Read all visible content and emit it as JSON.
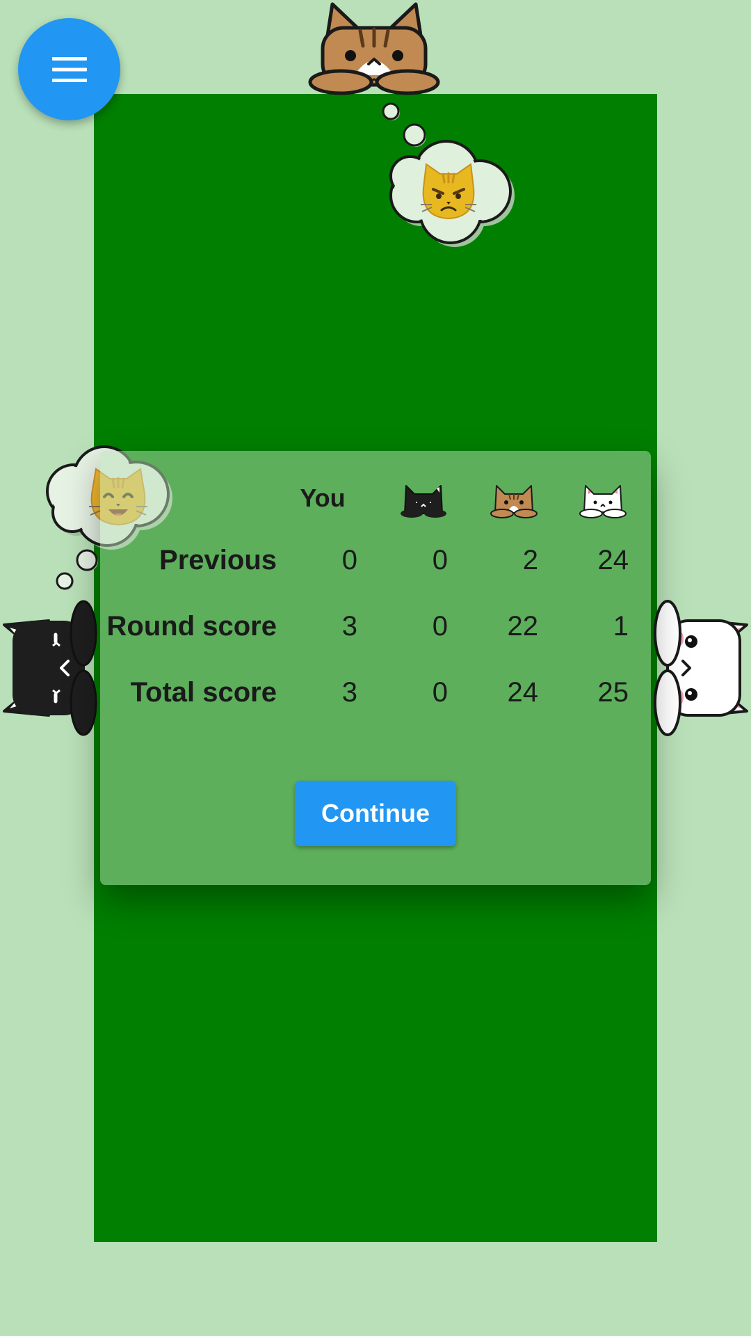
{
  "menu": {
    "icon": "hamburger-menu-icon"
  },
  "opponents": {
    "top": {
      "icon": "tabby-cat-icon",
      "thought_icon": "pouting-cat-face-icon"
    },
    "left": {
      "icon": "black-cat-icon",
      "thought_icon": "smiling-cat-face-icon"
    },
    "right": {
      "icon": "white-cat-icon"
    }
  },
  "scoreboard": {
    "columns": [
      {
        "label": "You"
      },
      {
        "icon": "black-cat-icon"
      },
      {
        "icon": "tabby-cat-icon"
      },
      {
        "icon": "white-cat-icon"
      }
    ],
    "rows": [
      {
        "label": "Previous",
        "values": [
          "0",
          "0",
          "2",
          "24"
        ]
      },
      {
        "label": "Round score",
        "values": [
          "3",
          "0",
          "22",
          "1"
        ]
      },
      {
        "label": "Total score",
        "values": [
          "3",
          "0",
          "24",
          "25"
        ]
      }
    ],
    "continue_label": "Continue"
  },
  "colors": {
    "background": "#b9e0b8",
    "felt": "#007f00",
    "accent": "#2196f3"
  }
}
